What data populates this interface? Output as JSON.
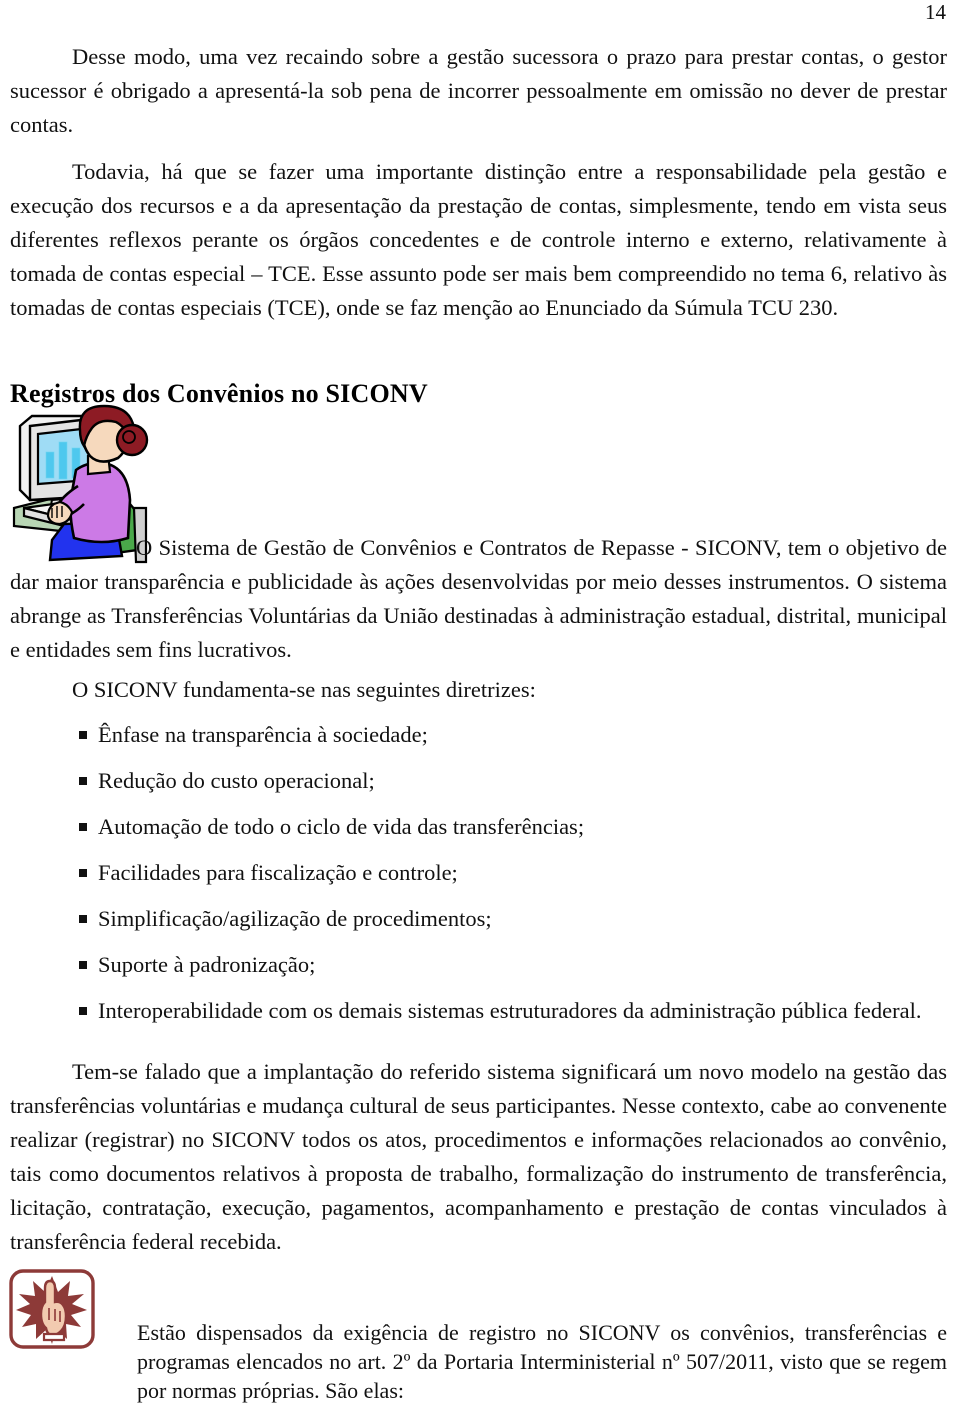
{
  "page": {
    "number": "14"
  },
  "paragraphs": {
    "p1": "Desse modo, uma vez recaindo sobre a gestão sucessora o prazo para prestar contas, o gestor sucessor é obrigado a apresentá-la sob pena de incorrer pessoalmente em omissão no dever de prestar contas.",
    "p2": "Todavia, há que se fazer uma importante distinção entre a responsabilidade pela gestão e execução dos recursos e a da apresentação da prestação de contas, simplesmente, tendo em vista seus diferentes reflexos perante os órgãos concedentes e de controle interno e externo, relativamente à tomada de contas especial – TCE. Esse assunto pode ser mais bem compreendido no tema 6, relativo às tomadas de contas especiais (TCE), onde se faz menção ao Enunciado da Súmula TCU 230.",
    "p3": "O Sistema de Gestão de Convênios e Contratos de Repasse - SICONV, tem o objetivo de dar maior transparência e publicidade às ações desenvolvidas por meio desses instrumentos. O sistema abrange as Transferências Voluntárias da União destinadas à administração estadual, distrital, municipal e entidades sem fins lucrativos.",
    "p4": "O SICONV fundamenta-se nas seguintes diretrizes:",
    "p5": "Tem-se falado que a implantação do referido sistema significará um novo modelo na gestão das transferências voluntárias e mudança cultural de seus participantes. Nesse contexto, cabe ao convenente realizar (registrar) no SICONV todos os atos, procedimentos e informações relacionados ao convênio, tais como documentos relativos à proposta de trabalho, formalização do instrumento de transferência, licitação, contratação, execução, pagamentos, acompanhamento e prestação de contas vinculados à transferência federal recebida.",
    "p6": "Estão dispensados da exigência de registro no SICONV os convênios, transferências e programas elencados no art. 2º da Portaria Interministerial nº 507/2011, visto que se regem por normas próprias. São elas:"
  },
  "heading": {
    "title": "Registros dos Convênios no SICONV"
  },
  "bullets": [
    {
      "text": "Ênfase na transparência à sociedade;"
    },
    {
      "text": "Redução do custo operacional;"
    },
    {
      "text": "Automação de todo o ciclo de vida das transferências;"
    },
    {
      "text": "Facilidades para fiscalização e controle;"
    },
    {
      "text": "Simplificação/agilização de procedimentos;"
    },
    {
      "text": "Suporte à padronização;"
    },
    {
      "text": "Interoperabilidade com os demais sistemas estruturadores da administração pública federal."
    }
  ],
  "illustrations": {
    "computer_user": {
      "name": "woman-at-computer-illustration",
      "colors": {
        "monitor_body": "#e8e8e8",
        "screen": "#9fdcf5",
        "chart_bars": "#4ec8ee",
        "desk": "#b8d6b4",
        "hair": "#8d1b24",
        "skin": "#f6d9bd",
        "shirt": "#cc7ae6",
        "chair": "#4aa84a",
        "pants": "#2233ee",
        "outline": "#000000"
      }
    },
    "attention_hand": {
      "name": "pointing-hand-attention-icon",
      "colors": {
        "border": "#8d3a38",
        "starburst": "#8d3a38",
        "skin": "#f2cbb0",
        "outline": "#8d3a38",
        "background": "#ffffff"
      }
    }
  },
  "colors": {
    "text": "#111111",
    "page_background": "#ffffff"
  }
}
